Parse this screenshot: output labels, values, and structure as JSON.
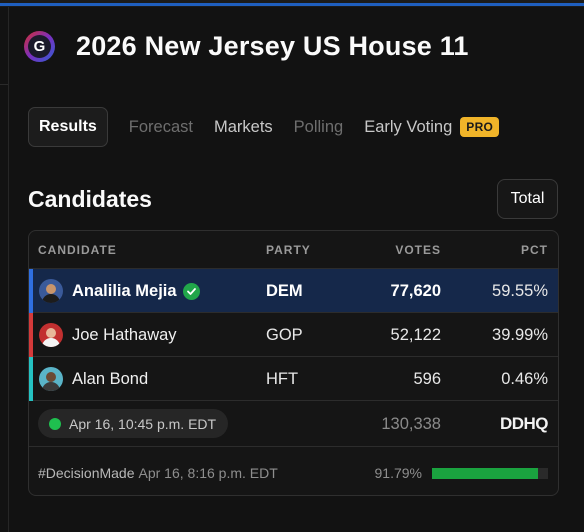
{
  "page": {
    "title": "2026 New Jersey US House 11",
    "logo_letter": "G"
  },
  "tabs": [
    {
      "label": "Results",
      "active": true
    },
    {
      "label": "Forecast",
      "disabled": true
    },
    {
      "label": "Markets"
    },
    {
      "label": "Polling",
      "disabled": true
    },
    {
      "label": "Early Voting",
      "badge": "PRO"
    }
  ],
  "candidates_section": {
    "title": "Candidates",
    "total_button": "Total"
  },
  "table": {
    "headers": {
      "candidate": "CANDIDATE",
      "party": "PARTY",
      "votes": "VOTES",
      "pct": "PCT"
    },
    "rows": [
      {
        "name": "Analilia Mejia",
        "party": "DEM",
        "votes": "77,620",
        "pct": "59.55%",
        "winner": true,
        "party_color": "#2f6fe0"
      },
      {
        "name": "Joe Hathaway",
        "party": "GOP",
        "votes": "52,122",
        "pct": "39.99%",
        "winner": false,
        "party_color": "#d43a3a"
      },
      {
        "name": "Alan Bond",
        "party": "HFT",
        "votes": "596",
        "pct": "0.46%",
        "winner": false,
        "party_color": "#25c2c2"
      }
    ],
    "status": {
      "updated": "Apr 16, 10:45 p.m. EDT",
      "total_votes": "130,338",
      "source_logo": "DDHQ"
    },
    "decision": {
      "label": "#DecisionMade",
      "time": "Apr 16, 8:16 p.m. EDT",
      "reporting_pct": "91.79%",
      "reporting_fraction": 0.9179
    }
  },
  "colors": {
    "accent_blue": "#1f5fbf",
    "winner_bg": "#15284a",
    "check_green": "#21a64a",
    "pro_badge": "#f0b429",
    "progress": "#1aa33f"
  }
}
